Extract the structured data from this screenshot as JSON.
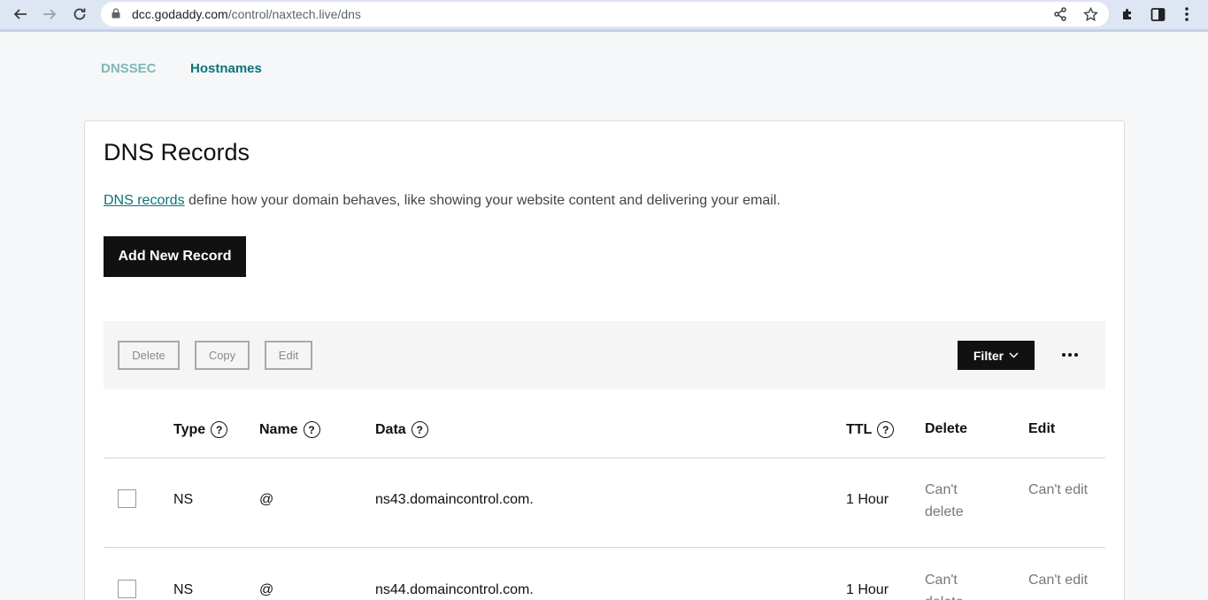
{
  "browser": {
    "url_domain": "dcc.godaddy.com",
    "url_path": "/control/naxtech.live/dns"
  },
  "tabs": [
    {
      "label": "DNSSEC"
    },
    {
      "label": "Hostnames"
    }
  ],
  "page": {
    "title": "DNS Records",
    "intro_link": "DNS records",
    "intro_rest": " define how your domain behaves, like showing your website content and delivering your email.",
    "add_button": "Add New Record"
  },
  "toolbar": {
    "delete_label": "Delete",
    "copy_label": "Copy",
    "edit_label": "Edit",
    "filter_label": "Filter"
  },
  "table": {
    "headers": {
      "type": "Type",
      "name": "Name",
      "data": "Data",
      "ttl": "TTL",
      "delete": "Delete",
      "edit": "Edit"
    },
    "rows": [
      {
        "type": "NS",
        "name": "@",
        "data": "ns43.domaincontrol.com.",
        "ttl": "1 Hour",
        "delete": "Can't delete",
        "edit": "Can't edit"
      },
      {
        "type": "NS",
        "name": "@",
        "data": "ns44.domaincontrol.com.",
        "ttl": "1 Hour",
        "delete": "Can't delete",
        "edit": "Can't edit"
      }
    ]
  }
}
